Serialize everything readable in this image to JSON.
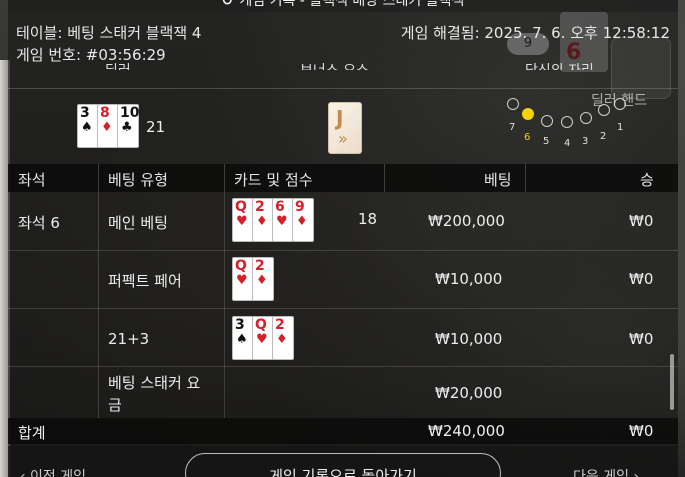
{
  "window": {
    "title": "게임 기록 - 블랙잭 배당 스태커 블랙잭"
  },
  "info": {
    "table": "테이블: 베팅 스태커 블랙잭 4",
    "game_no": "게임 번호: #03:56:29",
    "resolved": "게임 해결됨: 2025. 7. 6. 오후 12:58:12"
  },
  "section_headers": {
    "dealer": "딜러",
    "bonus": "보너스 요소",
    "your_seat": "당신의 자리",
    "dealer_hand": "딜러 핸드"
  },
  "dealer": {
    "cards": [
      {
        "rank": "3",
        "suit": "♠",
        "color": "#111111"
      },
      {
        "rank": "8",
        "suit": "♦",
        "color": "#d4202a"
      },
      {
        "rank": "10",
        "suit": "♣",
        "color": "#111111"
      }
    ],
    "score": "21"
  },
  "bonus_card": {
    "rank": "J",
    "suit": "»",
    "color": "#c48a4d"
  },
  "seats": {
    "labels": [
      "7",
      "6",
      "5",
      "4",
      "3",
      "2",
      "1"
    ],
    "active": "6"
  },
  "background": {
    "chip": "9",
    "card_rank": "6"
  },
  "table": {
    "headers": {
      "seat": "좌석",
      "bet_type": "베팅 유형",
      "cards_score": "카드 및 점수",
      "bet": "베팅",
      "win": "승"
    },
    "seat_label": "좌석 6",
    "rows": [
      {
        "bet_type": "메인 베팅",
        "cards": [
          {
            "rank": "Q",
            "suit": "♥",
            "color": "#d4202a"
          },
          {
            "rank": "2",
            "suit": "♦",
            "color": "#d4202a"
          },
          {
            "rank": "6",
            "suit": "♥",
            "color": "#d4202a"
          },
          {
            "rank": "9",
            "suit": "♦",
            "color": "#d4202a"
          }
        ],
        "score": "18",
        "bet": "₩200,000",
        "win": "₩0"
      },
      {
        "bet_type": "퍼펙트 페어",
        "cards": [
          {
            "rank": "Q",
            "suit": "♥",
            "color": "#d4202a"
          },
          {
            "rank": "2",
            "suit": "♦",
            "color": "#d4202a"
          }
        ],
        "score": "",
        "bet": "₩10,000",
        "win": "₩0"
      },
      {
        "bet_type": "21+3",
        "cards": [
          {
            "rank": "3",
            "suit": "♠",
            "color": "#111111"
          },
          {
            "rank": "Q",
            "suit": "♥",
            "color": "#d4202a"
          },
          {
            "rank": "2",
            "suit": "♦",
            "color": "#d4202a"
          }
        ],
        "score": "",
        "bet": "₩10,000",
        "win": "₩0"
      },
      {
        "bet_type_line1": "베팅 스태커 요",
        "bet_type_line2": "금",
        "bet": "₩20,000"
      }
    ],
    "total": {
      "label": "합계",
      "bet": "₩240,000",
      "win": "₩0"
    }
  },
  "footer": {
    "prev": "‹ 이전 게임",
    "back": "게임 기록으로 돌아가기",
    "next": "다음 게임 ›"
  }
}
